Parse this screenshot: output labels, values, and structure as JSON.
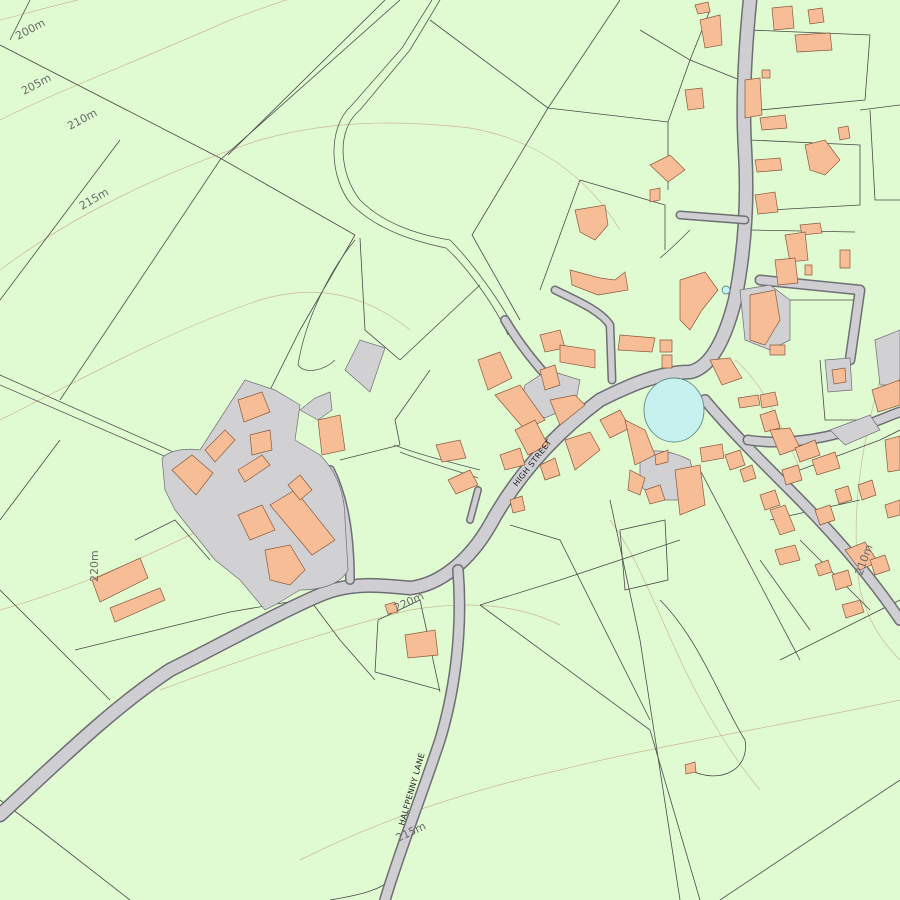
{
  "map": {
    "colors": {
      "land": "#e0fbd2",
      "building": "#f7bd96",
      "road": "#cfcfd3",
      "water": "#c7f1ef",
      "contour": "#c9b08c",
      "boundary": "#4a4a4a"
    },
    "contour_labels": {
      "c200": "200m",
      "c205": "205m",
      "c210": "210m",
      "c215": "215m",
      "c220": "220m",
      "c220b": "220m",
      "c210b": "210m",
      "c215b": "215m"
    },
    "road_labels": {
      "high_street": "HIGH STREET",
      "halfpenny_lane": "HALFPENNY LANE"
    }
  }
}
